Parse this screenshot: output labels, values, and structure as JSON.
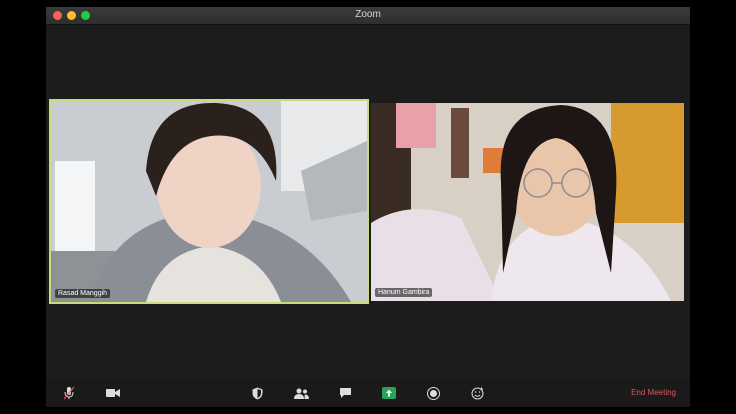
{
  "window": {
    "title": "Zoom"
  },
  "participants": [
    {
      "name": "Rasad Manggih",
      "active_speaker": true
    },
    {
      "name": "Hanum Gambira",
      "active_speaker": false
    }
  ],
  "toolbar": {
    "buttons": [
      {
        "icon": "microphone-muted-icon"
      },
      {
        "icon": "video-camera-icon"
      },
      {
        "icon": "shield-icon"
      },
      {
        "icon": "participants-icon"
      },
      {
        "icon": "chat-icon"
      },
      {
        "icon": "share-screen-icon"
      },
      {
        "icon": "record-icon"
      },
      {
        "icon": "reactions-icon"
      }
    ],
    "end_meeting_label": "End Meeting"
  },
  "colors": {
    "active_speaker_border": "#c8dc78",
    "share_button": "#23a55a",
    "end_meeting": "#e0535a"
  }
}
